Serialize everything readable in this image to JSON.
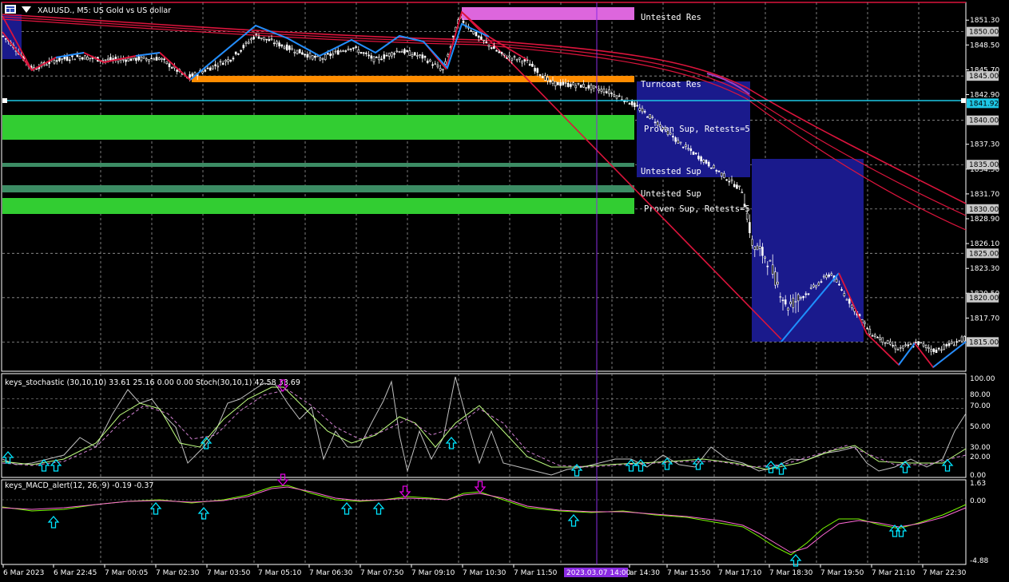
{
  "window": {
    "symbol_title": "XAUUSD., M5: US Gold vs US dollar",
    "menu_icon": "chart-menu-icon"
  },
  "main_axis": {
    "ticks": [
      "1851.30",
      "1848.50",
      "1845.70",
      "1842.90",
      "1837.30",
      "1834.50",
      "1831.70",
      "1828.90",
      "1826.10",
      "1823.30",
      "1820.50",
      "1817.70"
    ],
    "ymin": 1811.7,
    "ymax": 1853.3,
    "level_badges": [
      {
        "value": "1850.00",
        "color": "#c8c8c8"
      },
      {
        "value": "1845.00",
        "color": "#c8c8c8"
      },
      {
        "value": "1841.92",
        "color": "#1ec8e6"
      },
      {
        "value": "1840.00",
        "color": "#c8c8c8"
      },
      {
        "value": "1835.00",
        "color": "#c8c8c8"
      },
      {
        "value": "1830.00",
        "color": "#c8c8c8"
      },
      {
        "value": "1825.00",
        "color": "#c8c8c8"
      },
      {
        "value": "1820.00",
        "color": "#c8c8c8"
      },
      {
        "value": "1815.00",
        "color": "#c8c8c8"
      }
    ]
  },
  "zones": [
    {
      "label": "Untested Res",
      "color": "#dd66dd"
    },
    {
      "label": "Turncoat Res",
      "color": "#ff8c00"
    },
    {
      "label": "Proven Sup, Retests=5",
      "color": "#32cd32"
    },
    {
      "label": "Untested Sup",
      "color": "#3c8c64"
    },
    {
      "label": "Untested Sup",
      "color": "#3c8c64"
    },
    {
      "label": "Proven Sup, Retests=5",
      "color": "#32cd32"
    }
  ],
  "stochastic": {
    "title": "keys_stochastic (30,10,10) 33.61 25.16 0.00 0.00 Stoch(30,10,1) 42.58 33.69",
    "ticks": [
      "100.00",
      "80.00",
      "70.00",
      "50.00",
      "30.00",
      "20.00",
      "0.00"
    ]
  },
  "macd": {
    "title": "keys_MACD_alert(12, 26, 9) -0.19 -0.37",
    "ticks": [
      "1.63",
      "0.00",
      "-4.88"
    ]
  },
  "time_axis": {
    "labels": [
      "6 Mar 2023",
      "6 Mar 22:45",
      "7 Mar 00:05",
      "7 Mar 02:30",
      "7 Mar 03:50",
      "7 Mar 05:10",
      "7 Mar 06:30",
      "7 Mar 07:50",
      "7 Mar 09:10",
      "7 Mar 10:30",
      "7 Mar 11:50",
      "ar 14:30",
      "7 Mar 15:50",
      "7 Mar 17:10",
      "7 Mar 18:30",
      "7 Mar 19:50",
      "7 Mar 21:10",
      "7 Mar 22:30"
    ],
    "crosshair_label": "2023.03.07 14:00"
  },
  "colors": {
    "price_line": "#1ec8e6",
    "ma": "#dc143c",
    "zigzag": "#1e90ff",
    "sd_box": "#1a1a8c",
    "crosshair": "#8a2be2",
    "arrow_up": "#00e5ff",
    "arrow_down": "#e000e0"
  },
  "chart_data": {
    "type": "line",
    "series": [
      {
        "points": [
          [
            0,
            1849.8
          ],
          [
            15,
            1848.6
          ],
          [
            40,
            1845.8
          ],
          [
            70,
            1846.8
          ],
          [
            100,
            1847.2
          ],
          [
            130,
            1846.8
          ],
          [
            160,
            1846.9
          ],
          [
            200,
            1847.0
          ],
          [
            235,
            1844.8
          ],
          [
            260,
            1845.8
          ],
          [
            290,
            1847.0
          ],
          [
            320,
            1849.6
          ],
          [
            360,
            1848.2
          ],
          [
            400,
            1846.9
          ],
          [
            440,
            1848.3
          ],
          [
            470,
            1846.8
          ],
          [
            500,
            1847.9
          ],
          [
            530,
            1847.1
          ],
          [
            555,
            1845.6
          ],
          [
            575,
            1851.6
          ],
          [
            600,
            1849.3
          ],
          [
            630,
            1847.3
          ],
          [
            660,
            1846.6
          ],
          [
            690,
            1844.2
          ],
          [
            730,
            1843.9
          ],
          [
            760,
            1843.3
          ],
          [
            790,
            1842.0
          ],
          [
            820,
            1840.0
          ],
          [
            850,
            1837.5
          ],
          [
            870,
            1836.2
          ],
          [
            900,
            1834.2
          ],
          [
            930,
            1832.0
          ],
          [
            942,
            1826.0
          ],
          [
            960,
            1824.5
          ],
          [
            985,
            1819.0
          ],
          [
            1010,
            1820.5
          ],
          [
            1040,
            1822.8
          ],
          [
            1060,
            1820.0
          ],
          [
            1090,
            1816.0
          ],
          [
            1125,
            1814.2
          ],
          [
            1150,
            1814.9
          ],
          [
            1170,
            1814.0
          ],
          [
            1210,
            1815.5
          ]
        ]
      }
    ]
  }
}
